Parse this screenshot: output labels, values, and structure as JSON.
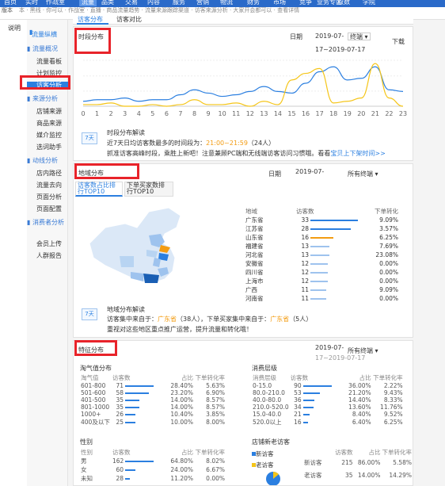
{
  "topnav": {
    "items": [
      "首页",
      "实时",
      "作战室",
      "流量",
      "品类",
      "交易",
      "内容",
      "服务",
      "营销",
      "物流",
      "财务",
      "市场",
      "竞争",
      "业务专区",
      "取数",
      "学院"
    ]
  },
  "subbar": {
    "left": "版本",
    "notice": "本 · 黑线 · 你可以 · 作战室 · 直播 · 商品流量趋势 · 流量来源跟踪渠道 · 访客来源分析 · 大家开会都可以 · 查看详情"
  },
  "leftstrip": {
    "text": "说明"
  },
  "sidebar": {
    "title": "流量纵横",
    "groups": [
      {
        "label": "流量概况",
        "items": [
          "流量看板",
          "计划监控",
          "访客分析"
        ]
      },
      {
        "label": "来源分析",
        "items": [
          "店铺来源",
          "商品来源",
          "媒介监控",
          "选词助手"
        ]
      },
      {
        "label": "动线分析",
        "items": [
          "店内路径",
          "流量去向",
          "页面分析",
          "页面配置"
        ]
      },
      {
        "label": "消费者分析",
        "items": [
          "会员上传",
          "人群报告"
        ]
      }
    ]
  },
  "tabs": {
    "active": "访客分布",
    "other": "访客对比"
  },
  "time_panel": {
    "title": "时段分布",
    "date_label": "日期",
    "date_value": "2019-07-",
    "date_range": "17~2019-07-17",
    "select": "终端",
    "download": "下载",
    "x_ticks": [
      "0",
      "1",
      "2",
      "3",
      "4",
      "5",
      "6",
      "7",
      "8",
      "9",
      "10",
      "11",
      "12",
      "13",
      "14",
      "15",
      "16",
      "17",
      "18",
      "19",
      "20",
      "21",
      "22",
      "23"
    ],
    "interp_icon": "7天",
    "interp_title": "时段分布解读",
    "interp_line1_prefix": "近7天日均访客数最多的时间段为：",
    "interp_line1_time": "21:00~21:59",
    "interp_line1_suffix": "（24人）",
    "interp_line2": "抓准访客高峰时段，乘胜上新吧！注意兼顾PC端和无线端访客访问习惯哦。看看",
    "interp_line2_link": "宝贝上下架时间>>"
  },
  "chart_data": {
    "type": "line",
    "x": [
      0,
      1,
      2,
      3,
      4,
      5,
      6,
      7,
      8,
      9,
      10,
      11,
      12,
      13,
      14,
      15,
      16,
      17,
      18,
      19,
      20,
      21,
      22,
      23
    ],
    "series": [
      {
        "color": "#2b7fe0",
        "values": [
          3,
          4,
          4,
          5,
          3,
          4,
          4,
          7,
          10,
          8,
          6,
          7,
          9,
          12,
          9,
          8,
          14,
          21,
          24,
          16,
          17,
          24,
          10,
          9
        ]
      },
      {
        "color": "#f5c518",
        "values": [
          1,
          1,
          2,
          0,
          0,
          1,
          0,
          1,
          4,
          1,
          1,
          2,
          0,
          3,
          1,
          16,
          20,
          23,
          2,
          3,
          5,
          26,
          5,
          0
        ]
      }
    ]
  },
  "region_panel": {
    "title": "地域分布",
    "date_label": "日期",
    "date_value": "2019-07-",
    "select": "所有终端",
    "tab1_line1": "访客数占比排",
    "tab1_line2": "行TOP10",
    "tab2_line1": "下单买家数排",
    "tab2_line2": "行TOP10",
    "col_region": "地域",
    "col_visitors": "访客数",
    "col_conv": "下单转化",
    "rows": [
      {
        "region": "广东省",
        "visitors": "33",
        "conv": "9.09%",
        "ratio": 1.0,
        "color": "#2b7fe0"
      },
      {
        "region": "江苏省",
        "visitors": "28",
        "conv": "3.57%",
        "ratio": 0.85,
        "color": "#2b7fe0"
      },
      {
        "region": "山东省",
        "visitors": "16",
        "conv": "6.25%",
        "ratio": 0.48,
        "color": "#f39c12"
      },
      {
        "region": "福建省",
        "visitors": "13",
        "conv": "7.69%",
        "ratio": 0.39,
        "color": "#9ec3ee"
      },
      {
        "region": "河北省",
        "visitors": "13",
        "conv": "23.08%",
        "ratio": 0.39,
        "color": "#9ec3ee"
      },
      {
        "region": "安徽省",
        "visitors": "12",
        "conv": "0.00%",
        "ratio": 0.36,
        "color": "#9ec3ee"
      },
      {
        "region": "四川省",
        "visitors": "12",
        "conv": "0.00%",
        "ratio": 0.36,
        "color": "#9ec3ee"
      },
      {
        "region": "上海市",
        "visitors": "12",
        "conv": "0.00%",
        "ratio": 0.36,
        "color": "#9ec3ee"
      },
      {
        "region": "广西",
        "visitors": "11",
        "conv": "9.09%",
        "ratio": 0.33,
        "color": "#9ec3ee"
      },
      {
        "region": "河南省",
        "visitors": "11",
        "conv": "0.00%",
        "ratio": 0.33,
        "color": "#9ec3ee"
      }
    ],
    "interp_icon": "7天",
    "interp_title": "地域分布解读",
    "interp_line1_a": "访客集中来自于：",
    "interp_line1_b": "广东省",
    "interp_line1_c": "（38人），下单买家集中来自于：",
    "interp_line1_d": "广东省",
    "interp_line1_e": "（5人）",
    "interp_line2": "重视对这些地区重点推广运营，提升流量和转化哦！"
  },
  "feature_panel": {
    "title": "特征分布",
    "date_value": "2019-07-",
    "date_range": "17~2019-07-17",
    "select": "所有终端",
    "naoqi": {
      "title": "淘气值分布",
      "cols": [
        "淘气值",
        "访客数",
        "占比",
        "下单转化率"
      ],
      "rows": [
        {
          "k": "601-800",
          "n": "71",
          "p": "28.40%",
          "c": "5.63%",
          "ratio": 1.0
        },
        {
          "k": "501-600",
          "n": "58",
          "p": "23.20%",
          "c": "6.90%",
          "ratio": 0.82
        },
        {
          "k": "401-500",
          "n": "35",
          "p": "14.00%",
          "c": "8.57%",
          "ratio": 0.49
        },
        {
          "k": "801-1000",
          "n": "35",
          "p": "14.00%",
          "c": "8.57%",
          "ratio": 0.49
        },
        {
          "k": "1000+",
          "n": "26",
          "p": "10.40%",
          "c": "3.85%",
          "ratio": 0.37
        },
        {
          "k": "400及以下",
          "n": "25",
          "p": "10.00%",
          "c": "8.00%",
          "ratio": 0.35
        }
      ]
    },
    "consume": {
      "title": "消费层级",
      "cols": [
        "消费层级",
        "访客数",
        "占比",
        "下单转化率"
      ],
      "rows": [
        {
          "k": "0-15.0",
          "n": "90",
          "p": "36.00%",
          "c": "2.22%",
          "ratio": 1.0
        },
        {
          "k": "80.0-210.0",
          "n": "53",
          "p": "21.20%",
          "c": "9.43%",
          "ratio": 0.59
        },
        {
          "k": "40.0-80.0",
          "n": "36",
          "p": "14.40%",
          "c": "8.33%",
          "ratio": 0.4
        },
        {
          "k": "210.0-520.0",
          "n": "34",
          "p": "13.60%",
          "c": "11.76%",
          "ratio": 0.38
        },
        {
          "k": "15.0-40.0",
          "n": "21",
          "p": "8.40%",
          "c": "9.52%",
          "ratio": 0.23
        },
        {
          "k": "520.0以上",
          "n": "16",
          "p": "6.40%",
          "c": "6.25%",
          "ratio": 0.18
        }
      ]
    },
    "gender": {
      "title": "性别",
      "cols": [
        "性别",
        "访客数",
        "占比",
        "下单转化率"
      ],
      "rows": [
        {
          "k": "男",
          "n": "162",
          "p": "64.80%",
          "c": "8.02%",
          "ratio": 1.0
        },
        {
          "k": "女",
          "n": "60",
          "p": "24.00%",
          "c": "6.67%",
          "ratio": 0.37
        },
        {
          "k": "未知",
          "n": "28",
          "p": "11.20%",
          "c": "0.00%",
          "ratio": 0.17
        }
      ]
    },
    "newold": {
      "title": "店铺新老访客",
      "legend_new": "新访客",
      "legend_old": "老访客",
      "cols": [
        "访客数",
        "占比",
        "下单转化率"
      ],
      "rows": [
        {
          "k": "新访客",
          "n": "215",
          "p": "86.00%",
          "c": "5.58%"
        },
        {
          "k": "老访客",
          "n": "35",
          "p": "14.00%",
          "c": "14.29%"
        }
      ],
      "new_share": 0.86
    }
  }
}
